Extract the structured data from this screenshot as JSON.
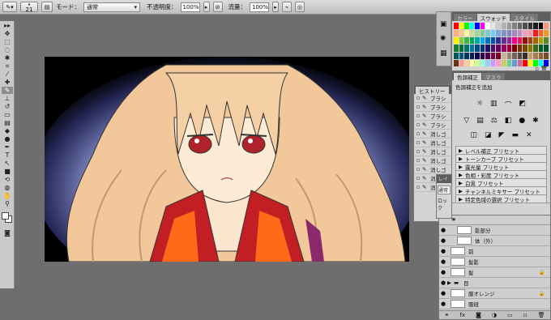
{
  "options_bar": {
    "brush_size": "21",
    "mode_label": "モード：",
    "mode_value": "通常",
    "opacity_label": "不透明度：",
    "opacity_value": "100%",
    "flow_label": "流量：",
    "flow_value": "100%"
  },
  "swatches_panel": {
    "tabs": [
      "カラー",
      "スウォッチ",
      "スタイル"
    ],
    "active_tab": "スウォッチ"
  },
  "history_panel": {
    "title": "ヒストリー",
    "items": [
      "ブラシ",
      "ブラシ",
      "ブラシ",
      "ブラシ",
      "消しゴ",
      "消しゴ",
      "消しゴ",
      "消しゴ",
      "消しゴ",
      "消しゴ",
      "消しゴ"
    ]
  },
  "adjustments_panel": {
    "tabs": [
      "色調補正",
      "マスク"
    ],
    "header": "色調補正を追加",
    "presets": [
      "レベル補正 プリセット",
      "トーンカーブ プリセット",
      "露光量 プリセット",
      "色相・彩度 プリセット",
      "白黒 プリセット",
      "チャンネルミキサー プリセット",
      "特定色域の選択 プリセット"
    ]
  },
  "layers_panel": {
    "peek_labels": [
      "レイ",
      "通常",
      "ロック"
    ],
    "layers": [
      {
        "name": "影部分",
        "indent": true
      },
      {
        "name": "体（外）",
        "indent": true
      },
      {
        "name": "前",
        "indent": false
      },
      {
        "name": "髪影",
        "indent": false
      },
      {
        "name": "髪",
        "indent": false
      },
      {
        "name": "目",
        "indent": false,
        "group": true
      },
      {
        "name": "服オレンジ",
        "indent": false
      },
      {
        "name": "服紐",
        "indent": false
      }
    ]
  }
}
